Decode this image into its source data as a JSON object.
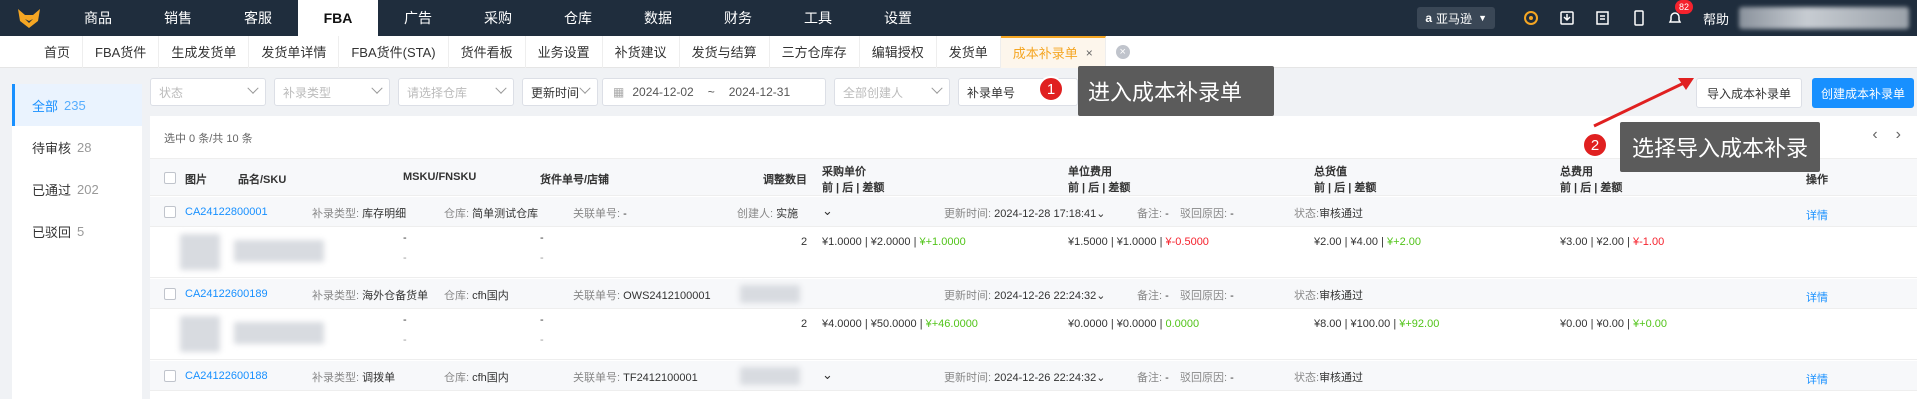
{
  "topnav": {
    "items": [
      "商品",
      "销售",
      "客服",
      "FBA",
      "广告",
      "采购",
      "仓库",
      "数据",
      "财务",
      "工具",
      "设置"
    ],
    "active_index": 3,
    "amazon": "亚马逊",
    "badge_count": "82",
    "help": "帮助"
  },
  "tabs": [
    "首页",
    "FBA货件",
    "生成发货单",
    "发货单详情",
    "FBA货件(STA)",
    "货件看板",
    "业务设置",
    "补货建议",
    "发货与结算",
    "三方仓库存",
    "编辑授权",
    "发货单",
    "成本补录单"
  ],
  "active_tab": "成本补录单",
  "status_list": [
    {
      "label": "全部",
      "count": "235"
    },
    {
      "label": "待审核",
      "count": "28"
    },
    {
      "label": "已通过",
      "count": "202"
    },
    {
      "label": "已驳回",
      "count": "5"
    }
  ],
  "filters": {
    "status": "状态",
    "supplement_type": "补录类型",
    "warehouse": "请选择仓库",
    "time_type": "更新时间",
    "date_start": "2024-12-02",
    "date_sep": "~",
    "date_end": "2024-12-31",
    "creator": "全部创建人",
    "doc_no": "补录单号"
  },
  "buttons": {
    "import": "导入成本补录单",
    "create": "创建成本补录单"
  },
  "selection_info": "选中 0 条/共 10 条",
  "table": {
    "headers": {
      "image": "图片",
      "name_sku": "品名/SKU",
      "msku": "MSKU/FNSKU",
      "shipment": "货件单号/店铺",
      "adjust_qty": "调整数目",
      "purchase_price": "采购单价",
      "unit_fee": "单位费用",
      "total_value": "总货值",
      "total_fee": "总费用",
      "sub": "前 | 后 | 差额",
      "op": "操作"
    },
    "groups": [
      {
        "id": "CA24122800001",
        "type_label": "补录类型:",
        "type": "库存明细",
        "wh_label": "仓库:",
        "wh": "简单测试仓库",
        "rel_label": "关联单号:",
        "rel": "-",
        "creator_label": "创建人:",
        "creator": "实施",
        "upd_label": "更新时间:",
        "upd": "2024-12-28 17:18:41",
        "note_label": "备注:",
        "note": "-",
        "reject_label": "驳回原因:",
        "reject": "-",
        "status_label": "状态:",
        "status": "审核通过",
        "op": "详情",
        "row": {
          "msku": "-",
          "msku2": "-",
          "ship": "-",
          "ship2": "-",
          "qty": "2",
          "pp_before": "¥1.0000",
          "pp_after": "¥2.0000",
          "pp_diff": "¥+1.0000",
          "uf_before": "¥1.5000",
          "uf_after": "¥1.0000",
          "uf_diff": "¥-0.5000",
          "tv_before": "¥2.00",
          "tv_after": "¥4.00",
          "tv_diff": "¥+2.00",
          "tf_before": "¥3.00",
          "tf_after": "¥2.00",
          "tf_diff": "¥-1.00"
        }
      },
      {
        "id": "CA24122600189",
        "type_label": "补录类型:",
        "type": "海外仓备货单",
        "wh_label": "仓库:",
        "wh": "cfh国内",
        "rel_label": "关联单号:",
        "rel": "OWS2412100001",
        "upd_label": "更新时间:",
        "upd": "2024-12-26 22:24:32",
        "note_label": "备注:",
        "note": "-",
        "reject_label": "驳回原因:",
        "reject": "-",
        "status_label": "状态:",
        "status": "审核通过",
        "op": "详情",
        "row": {
          "msku": "-",
          "msku2": "-",
          "ship": "-",
          "ship2": "-",
          "qty": "2",
          "pp_before": "¥4.0000",
          "pp_after": "¥50.0000",
          "pp_diff": "¥+46.0000",
          "uf_before": "¥0.0000",
          "uf_after": "¥0.0000",
          "uf_diff": "0.0000",
          "tv_before": "¥8.00",
          "tv_after": "¥100.00",
          "tv_diff": "¥+92.00",
          "tf_before": "¥0.00",
          "tf_after": "¥0.00",
          "tf_diff": "¥+0.00"
        }
      },
      {
        "id": "CA24122600188",
        "type_label": "补录类型:",
        "type": "调拨单",
        "wh_label": "仓库:",
        "wh": "cfh国内",
        "rel_label": "关联单号:",
        "rel": "TF2412100001",
        "upd_label": "更新时间:",
        "upd": "2024-12-26 22:24:32",
        "note_label": "备注:",
        "note": "-",
        "reject_label": "驳回原因:",
        "reject": "-",
        "status_label": "状态:",
        "status": "审核通过",
        "op": "详情"
      }
    ]
  },
  "callouts": [
    {
      "num": "1",
      "text": "进入成本补录单"
    },
    {
      "num": "2",
      "text": "选择导入成本补录"
    }
  ]
}
